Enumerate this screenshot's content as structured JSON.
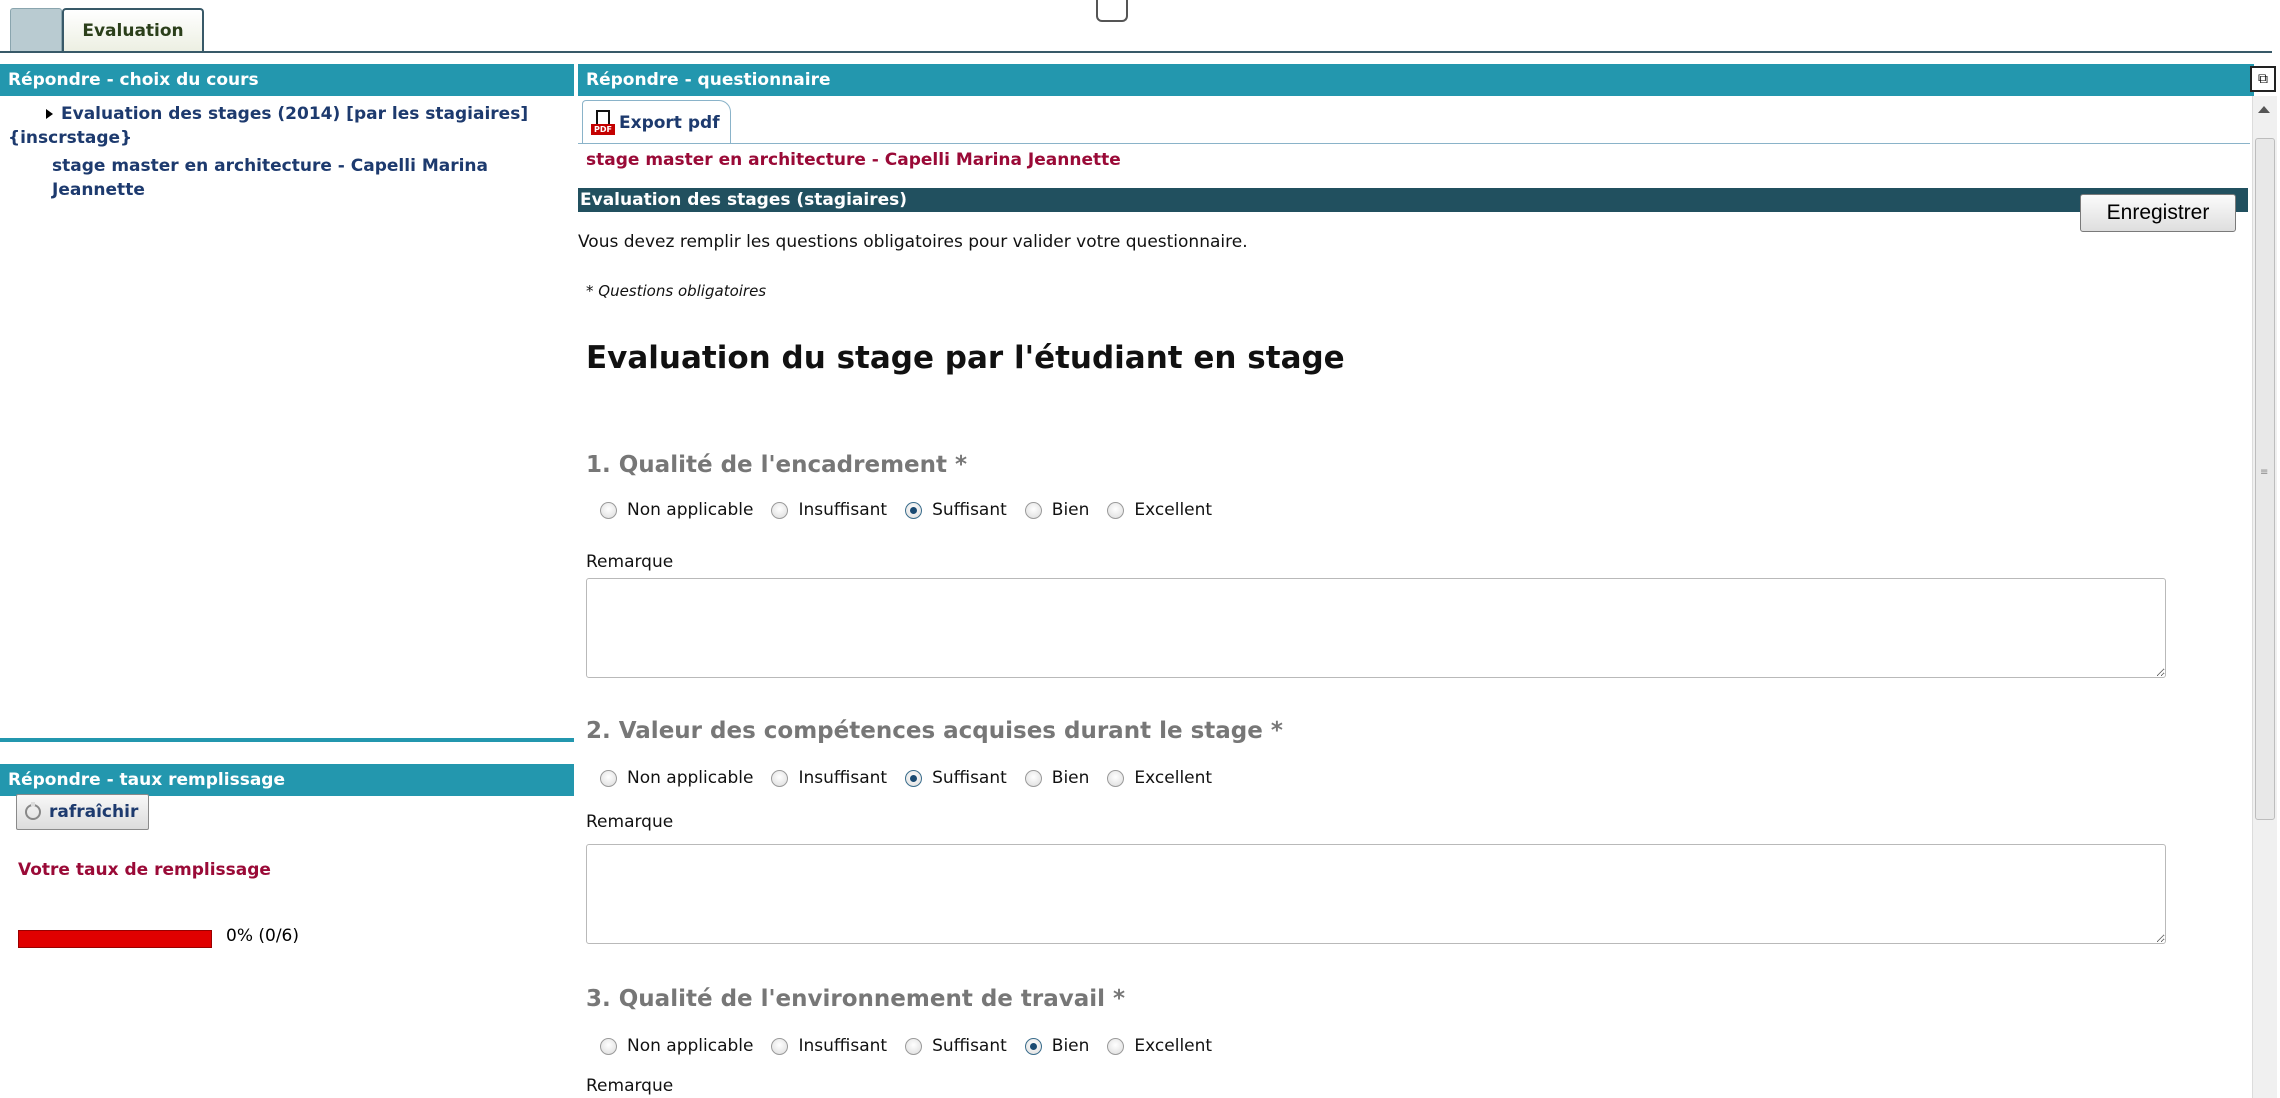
{
  "tabs": {
    "active_label": "Evaluation"
  },
  "left_top_panel": {
    "title": "Répondre - choix du cours",
    "course_parent": "Evaluation des stages (2014) [par les stagiaires] {inscrstage}",
    "course_child": "stage master en architecture - Capelli Marina Jeannette"
  },
  "left_bottom_panel": {
    "title": "Répondre - taux remplissage",
    "refresh_label": "rafraîchir",
    "fill_label": "Votre taux de remplissage",
    "progress_value": 0,
    "progress_text": "0% (0/6)"
  },
  "right_panel": {
    "title": "Répondre - questionnaire",
    "export_label": "Export pdf",
    "stage_title": "stage master en architecture - Capelli Marina Jeannette",
    "section_title": "Evaluation des stages (stagiaires)",
    "save_label": "Enregistrer",
    "info_text": "Vous devez remplir les questions obligatoires pour valider votre questionnaire.",
    "mandatory_note": "* Questions obligatoires",
    "form_heading": "Evaluation du stage par l'étudiant en stage",
    "remark_label": "Remarque",
    "options": [
      "Non applicable",
      "Insuffisant",
      "Suffisant",
      "Bien",
      "Excellent"
    ],
    "questions": [
      {
        "title": "1. Qualité de l'encadrement *",
        "selected": "Suffisant"
      },
      {
        "title": "2. Valeur des compétences acquises durant le stage *",
        "selected": "Suffisant"
      },
      {
        "title": "3. Qualité de l'environnement de travail *",
        "selected": "Bien"
      }
    ]
  },
  "colors": {
    "panel_header": "#2397ae",
    "section_bar": "#21505f",
    "accent_text": "#9a0a37",
    "link_text": "#1d3a6e",
    "progress_empty": "#e00000"
  }
}
